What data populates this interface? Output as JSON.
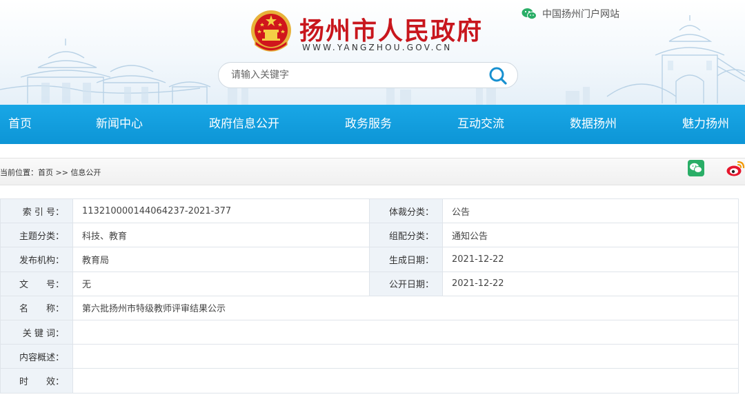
{
  "header": {
    "site_title": "扬州市人民政府",
    "site_url": "WWW.YANGZHOU.GOV.CN",
    "portal_link": "中国扬州门户网站",
    "search_placeholder": "请输入关键字"
  },
  "nav": [
    "首页",
    "新闻中心",
    "政府信息公开",
    "政务服务",
    "互动交流",
    "数据扬州",
    "魅力扬州"
  ],
  "breadcrumb": {
    "prefix": "当前位置：",
    "home": "首页",
    "separator": " >> ",
    "current": "信息公开"
  },
  "info": {
    "index_label": "索 引 号：",
    "index_value": "113210000144064237-2021-377",
    "genre_label": "体裁分类：",
    "genre_value": "公告",
    "topic_label": "主题分类：",
    "topic_value": "科技、教育",
    "group_label": "组配分类：",
    "group_value": "通知公告",
    "publisher_label": "发布机构：",
    "publisher_value": "教育局",
    "created_label": "生成日期：",
    "created_value": "2021-12-22",
    "docno_label": "文　　号：",
    "docno_value": "无",
    "published_label": "公开日期：",
    "published_value": "2021-12-22",
    "name_label": "名　　称：",
    "name_value": "第六批扬州市特级教师评审结果公示",
    "keywords_label": "关 键 词：",
    "keywords_value": "",
    "summary_label": "内容概述：",
    "summary_value": "",
    "validity_label": "时　　效：",
    "validity_value": ""
  },
  "colors": {
    "nav_blue": "#0d95d6",
    "title_red": "#c8161d",
    "emblem_gold": "#e7b23a",
    "wechat_green": "#2aae67",
    "weibo_red": "#e6162d"
  },
  "icons": {
    "emblem": "national-emblem-icon",
    "portal": "wechat-icon",
    "search": "search-icon",
    "share_wechat": "wechat-share-icon",
    "share_weibo": "weibo-share-icon"
  }
}
